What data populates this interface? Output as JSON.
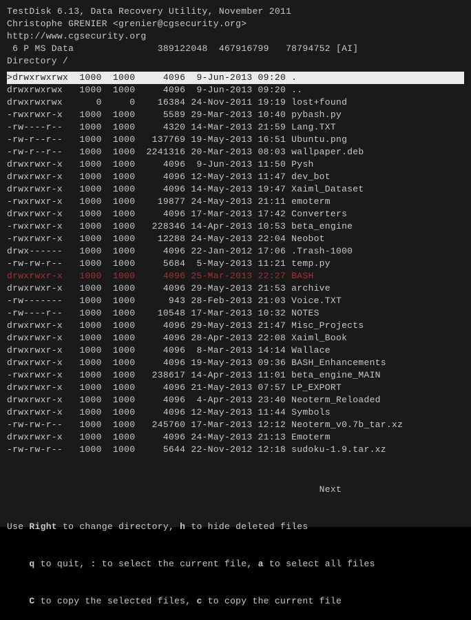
{
  "header": {
    "title_line": "TestDisk 6.13, Data Recovery Utility, November 2011",
    "author_line": "Christophe GRENIER <grenier@cgsecurity.org>",
    "url_line": "http://www.cgsecurity.org",
    "partition_line": " 6 P MS Data               389122048  467916799   78794752 [AI]",
    "directory_line": "Directory /"
  },
  "cols": {
    "perm_w": 11,
    "uid_w": 6,
    "gid_w": 6,
    "size_w": 9,
    "date_w": 12,
    "time_w": 5
  },
  "rows": [
    {
      "perm": ">drwxrwxrwx",
      "uid": "1000",
      "gid": "1000",
      "size": "4096",
      "date": "9-Jun-2013",
      "time": "09:20",
      "name": ".",
      "selected": true
    },
    {
      "perm": "drwxrwxrwx",
      "uid": "1000",
      "gid": "1000",
      "size": "4096",
      "date": "9-Jun-2013",
      "time": "09:20",
      "name": ".."
    },
    {
      "perm": "drwxrwxrwx",
      "uid": "0",
      "gid": "0",
      "size": "16384",
      "date": "24-Nov-2011",
      "time": "19:19",
      "name": "lost+found"
    },
    {
      "perm": "-rwxrwxr-x",
      "uid": "1000",
      "gid": "1000",
      "size": "5589",
      "date": "29-Mar-2013",
      "time": "10:40",
      "name": "pybash.py"
    },
    {
      "perm": "-rw----r--",
      "uid": "1000",
      "gid": "1000",
      "size": "4320",
      "date": "14-Mar-2013",
      "time": "21:59",
      "name": "Lang.TXT"
    },
    {
      "perm": "-rw-r--r--",
      "uid": "1000",
      "gid": "1000",
      "size": "137769",
      "date": "19-May-2013",
      "time": "16:51",
      "name": "Ubuntu.png"
    },
    {
      "perm": "-rw-r--r--",
      "uid": "1000",
      "gid": "1000",
      "size": "2241316",
      "date": "20-Mar-2013",
      "time": "08:03",
      "name": "wallpaper.deb"
    },
    {
      "perm": "drwxrwxr-x",
      "uid": "1000",
      "gid": "1000",
      "size": "4096",
      "date": "9-Jun-2013",
      "time": "11:50",
      "name": "Pysh"
    },
    {
      "perm": "drwxrwxr-x",
      "uid": "1000",
      "gid": "1000",
      "size": "4096",
      "date": "12-May-2013",
      "time": "11:47",
      "name": "dev_bot"
    },
    {
      "perm": "drwxrwxr-x",
      "uid": "1000",
      "gid": "1000",
      "size": "4096",
      "date": "14-May-2013",
      "time": "19:47",
      "name": "Xaiml_Dataset"
    },
    {
      "perm": "-rwxrwxr-x",
      "uid": "1000",
      "gid": "1000",
      "size": "19877",
      "date": "24-May-2013",
      "time": "21:11",
      "name": "emoterm"
    },
    {
      "perm": "drwxrwxr-x",
      "uid": "1000",
      "gid": "1000",
      "size": "4096",
      "date": "17-Mar-2013",
      "time": "17:42",
      "name": "Converters"
    },
    {
      "perm": "-rwxrwxr-x",
      "uid": "1000",
      "gid": "1000",
      "size": "228346",
      "date": "14-Apr-2013",
      "time": "10:53",
      "name": "beta_engine"
    },
    {
      "perm": "-rwxrwxr-x",
      "uid": "1000",
      "gid": "1000",
      "size": "12288",
      "date": "24-May-2013",
      "time": "22:04",
      "name": "Neobot"
    },
    {
      "perm": "drwx------",
      "uid": "1000",
      "gid": "1000",
      "size": "4096",
      "date": "22-Jan-2012",
      "time": "17:06",
      "name": ".Trash-1000"
    },
    {
      "perm": "-rw-rw-r--",
      "uid": "1000",
      "gid": "1000",
      "size": "5684",
      "date": "5-May-2013",
      "time": "11:21",
      "name": "temp.py"
    },
    {
      "perm": "drwxrwxr-x",
      "uid": "1000",
      "gid": "1000",
      "size": "4096",
      "date": "25-Mar-2013",
      "time": "22:27",
      "name": "BASH",
      "deleted": true
    },
    {
      "perm": "drwxrwxr-x",
      "uid": "1000",
      "gid": "1000",
      "size": "4096",
      "date": "29-May-2013",
      "time": "21:53",
      "name": "archive"
    },
    {
      "perm": "-rw-------",
      "uid": "1000",
      "gid": "1000",
      "size": "943",
      "date": "28-Feb-2013",
      "time": "21:03",
      "name": "Voice.TXT"
    },
    {
      "perm": "-rw----r--",
      "uid": "1000",
      "gid": "1000",
      "size": "10548",
      "date": "17-Mar-2013",
      "time": "10:32",
      "name": "NOTES"
    },
    {
      "perm": "drwxrwxr-x",
      "uid": "1000",
      "gid": "1000",
      "size": "4096",
      "date": "29-May-2013",
      "time": "21:47",
      "name": "Misc_Projects"
    },
    {
      "perm": "drwxrwxr-x",
      "uid": "1000",
      "gid": "1000",
      "size": "4096",
      "date": "28-Apr-2013",
      "time": "22:08",
      "name": "Xaiml_Book"
    },
    {
      "perm": "drwxrwxr-x",
      "uid": "1000",
      "gid": "1000",
      "size": "4096",
      "date": "8-Mar-2013",
      "time": "14:14",
      "name": "Wallace"
    },
    {
      "perm": "drwxrwxr-x",
      "uid": "1000",
      "gid": "1000",
      "size": "4096",
      "date": "19-May-2013",
      "time": "09:36",
      "name": "BASH_Enhancements"
    },
    {
      "perm": "-rwxrwxr-x",
      "uid": "1000",
      "gid": "1000",
      "size": "238617",
      "date": "14-Apr-2013",
      "time": "11:01",
      "name": "beta_engine_MAIN"
    },
    {
      "perm": "drwxrwxr-x",
      "uid": "1000",
      "gid": "1000",
      "size": "4096",
      "date": "21-May-2013",
      "time": "07:57",
      "name": "LP_EXPORT"
    },
    {
      "perm": "drwxrwxr-x",
      "uid": "1000",
      "gid": "1000",
      "size": "4096",
      "date": "4-Apr-2013",
      "time": "23:40",
      "name": "Neoterm_Reloaded"
    },
    {
      "perm": "drwxrwxr-x",
      "uid": "1000",
      "gid": "1000",
      "size": "4096",
      "date": "12-May-2013",
      "time": "11:44",
      "name": "Symbols"
    },
    {
      "perm": "-rw-rw-r--",
      "uid": "1000",
      "gid": "1000",
      "size": "245760",
      "date": "17-Mar-2013",
      "time": "12:12",
      "name": "Neoterm_v0.7b_tar.xz"
    },
    {
      "perm": "drwxrwxr-x",
      "uid": "1000",
      "gid": "1000",
      "size": "4096",
      "date": "24-May-2013",
      "time": "21:13",
      "name": "Emoterm"
    },
    {
      "perm": "-rw-rw-r--",
      "uid": "1000",
      "gid": "1000",
      "size": "5644",
      "date": "22-Nov-2012",
      "time": "12:18",
      "name": "sudoku-1.9.tar.xz"
    }
  ],
  "pager": {
    "next_label": "Next"
  },
  "help": {
    "line1_a": "Use ",
    "line1_b": "Right",
    "line1_c": " to change directory, ",
    "line1_d": "h",
    "line1_e": " to hide deleted files",
    "line2_a": "    ",
    "line2_b": "q",
    "line2_c": " to quit, ",
    "line2_d": ":",
    "line2_e": " to select the current file, ",
    "line2_f": "a",
    "line2_g": " to select all files",
    "line3_a": "    ",
    "line3_b": "C",
    "line3_c": " to copy the selected files, ",
    "line3_d": "c",
    "line3_e": " to copy the current file"
  }
}
